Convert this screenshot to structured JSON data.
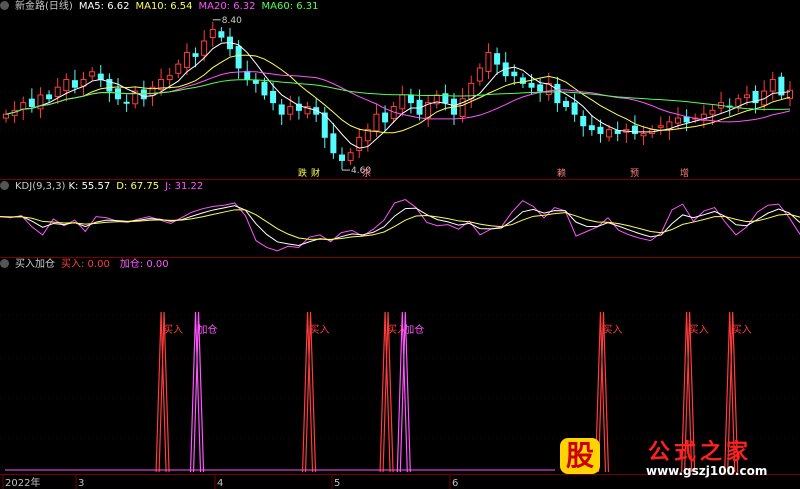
{
  "colors": {
    "up": "#ff3c3c",
    "down": "#54fcfc",
    "ma5": "#ffffff",
    "ma10": "#ffff54",
    "ma20": "#ff54ff",
    "ma60": "#54ff54",
    "k": "#ffffff",
    "d": "#ffff54",
    "j": "#ff54ff",
    "buy": "#ff3c3c",
    "add": "#ff54ff",
    "divider": "#7a0000",
    "text": "#c0c0c0"
  },
  "main_header": {
    "title": "新金路(日线)",
    "ma5": "MA5: 6.62",
    "ma10": "MA10: 6.54",
    "ma20": "MA20: 6.32",
    "ma60": "MA60: 6.31"
  },
  "kdj_header": {
    "title": "KDJ(9,3,3)",
    "k": "K: 55.57",
    "d": "D: 67.75",
    "j": "J: 31.22"
  },
  "signal_header": {
    "title": "买入加仓",
    "buy": "买入: 0.00",
    "add": "加仓: 0.00"
  },
  "x_axis": {
    "labels": [
      "2022年",
      "3",
      "4",
      "5",
      "6"
    ]
  },
  "chart_data": [
    {
      "type": "candlestick",
      "title": "新金路(日线)",
      "series": [
        {
          "name": "MA5",
          "last": 6.62
        },
        {
          "name": "MA10",
          "last": 6.54
        },
        {
          "name": "MA20",
          "last": 6.32
        },
        {
          "name": "MA60",
          "last": 6.31
        }
      ],
      "high_label": "8.40",
      "low_label": "4.60",
      "price_range": [
        4.5,
        8.6
      ],
      "close_path": [
        6.0,
        6.1,
        6.3,
        6.2,
        6.5,
        6.4,
        6.7,
        6.9,
        6.7,
        6.9,
        7.1,
        6.9,
        6.6,
        6.4,
        6.3,
        6.6,
        6.4,
        6.7,
        6.9,
        7.0,
        7.3,
        7.6,
        7.5,
        7.9,
        8.2,
        8.0,
        7.7,
        7.2,
        6.9,
        6.8,
        6.5,
        6.3,
        6.0,
        6.2,
        6.1,
        6.2,
        6.0,
        5.4,
        5.0,
        4.8,
        5.0,
        5.4,
        5.6,
        6.0,
        5.8,
        6.2,
        6.5,
        6.3,
        6.0,
        6.3,
        6.5,
        6.3,
        6.0,
        6.4,
        6.8,
        7.2,
        7.6,
        7.3,
        7.0,
        7.0,
        6.8,
        6.7,
        6.6,
        6.8,
        6.3,
        6.2,
        6.0,
        5.7,
        5.6,
        5.5,
        5.6,
        5.5,
        5.6,
        5.5,
        5.5,
        5.6,
        5.7,
        5.8,
        5.9,
        5.8,
        5.9,
        6.0,
        6.1,
        6.3,
        6.2,
        6.4,
        6.5,
        6.3,
        6.6,
        6.9,
        6.5,
        6.62
      ],
      "annotations": [
        "跌",
        "财",
        "杀",
        "赖",
        "预",
        "增"
      ]
    },
    {
      "type": "line",
      "title": "KDJ(9,3,3)",
      "series": [
        {
          "name": "K",
          "last": 55.57
        },
        {
          "name": "D",
          "last": 67.75
        },
        {
          "name": "J",
          "last": 31.22
        }
      ],
      "j_path": [
        62,
        60,
        64,
        44,
        30,
        58,
        46,
        56,
        36,
        62,
        60,
        54,
        52,
        58,
        62,
        56,
        50,
        60,
        70,
        76,
        80,
        82,
        86,
        64,
        20,
        8,
        2,
        10,
        8,
        26,
        30,
        18,
        34,
        38,
        28,
        40,
        56,
        86,
        92,
        78,
        52,
        46,
        48,
        40,
        54,
        30,
        40,
        44,
        70,
        90,
        80,
        60,
        78,
        72,
        28,
        36,
        44,
        60,
        38,
        30,
        24,
        20,
        34,
        74,
        84,
        54,
        72,
        78,
        52,
        30,
        44,
        70,
        82,
        84,
        60,
        31
      ]
    },
    {
      "type": "bar",
      "title": "买入加仓",
      "series": [
        {
          "name": "买入",
          "last": 0.0
        },
        {
          "name": "加仓",
          "last": 0.0
        }
      ],
      "signal_label_buy": "买入",
      "signal_label_add": "加仓",
      "signals": [
        {
          "type": "买入",
          "label": "买入",
          "index": 22
        },
        {
          "type": "加仓",
          "label": "加仓",
          "index": 26
        },
        {
          "type": "买入",
          "label": "买入",
          "index": 42
        },
        {
          "type": "买入",
          "label": "买入",
          "index": 53
        },
        {
          "type": "加仓",
          "label": "加仓",
          "index": 55
        },
        {
          "type": "买入",
          "label": "买入",
          "index": 83
        },
        {
          "type": "买入",
          "label": "买入",
          "index": 96
        },
        {
          "type": "买入",
          "label": "买入",
          "index": 101
        }
      ]
    }
  ],
  "watermark": {
    "logo": "股",
    "text": "公式之家",
    "url": "www.gszj100.com"
  }
}
